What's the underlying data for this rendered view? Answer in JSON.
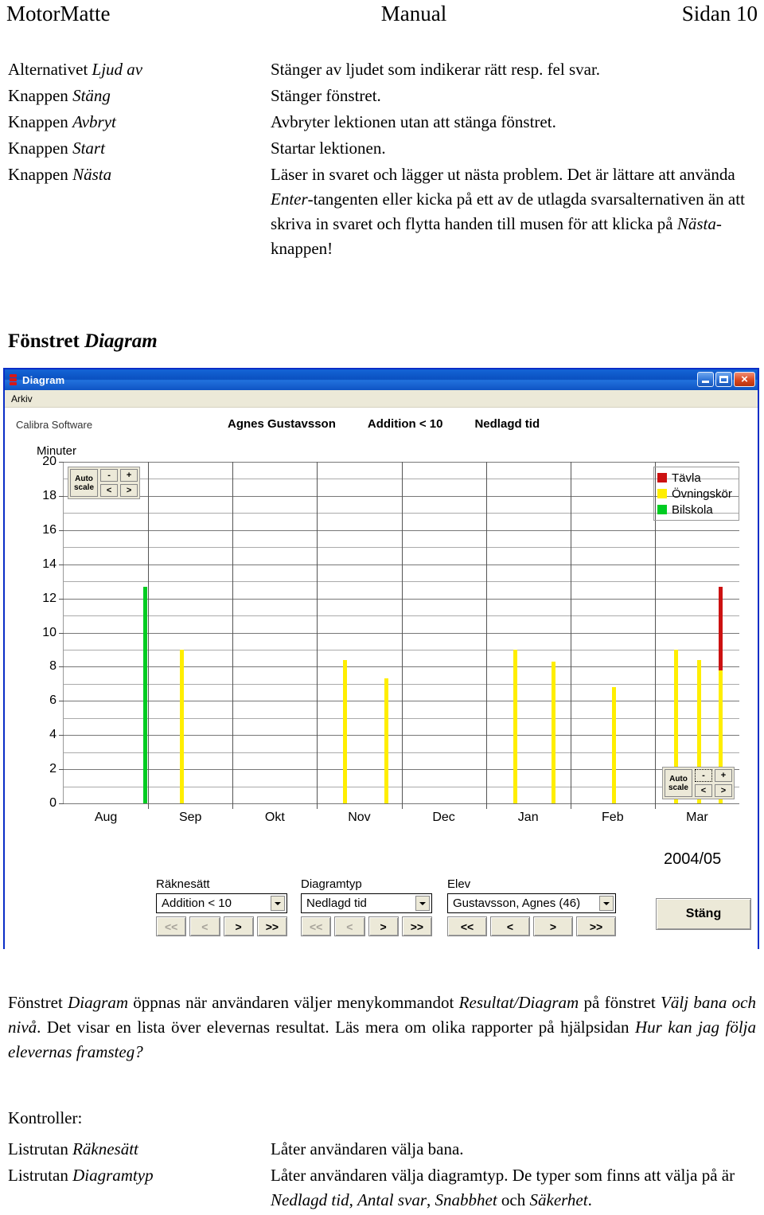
{
  "page_header": {
    "left": "MotorMatte",
    "center": "Manual",
    "right": "Sidan 10"
  },
  "definitions_top": [
    {
      "term_prefix": "Alternativet ",
      "term_italic": "Ljud av",
      "desc": "Stänger av ljudet som indikerar rätt resp. fel svar."
    },
    {
      "term_prefix": "Knappen ",
      "term_italic": "Stäng",
      "desc": "Stänger fönstret."
    },
    {
      "term_prefix": "Knappen ",
      "term_italic": "Avbryt",
      "desc": "Avbryter lektionen utan att stänga fönstret."
    },
    {
      "term_prefix": "Knappen ",
      "term_italic": "Start",
      "desc": "Startar lektionen."
    },
    {
      "term_prefix": "Knappen ",
      "term_italic": "Nästa",
      "desc_part1": "Läser in svaret och lägger ut nästa problem. Det är lättare att använda ",
      "desc_it1": "Enter",
      "desc_part2": "-tangenten eller kicka på ett av de utlagda svarsalternativen än att skriva in svaret och flytta handen till musen för att klicka på ",
      "desc_it2": "Nästa",
      "desc_part3": "-knappen!"
    }
  ],
  "section_heading": {
    "text": "Fönstret ",
    "italic": "Diagram"
  },
  "window": {
    "title": "Diagram",
    "titlebar_icon": "traffic-light-icon",
    "menu": [
      "Arkiv"
    ],
    "minimize_label": "minimize-icon",
    "maximize_label": "maximize-icon",
    "close_label": "×",
    "brand": "Calibra Software",
    "header_labels": [
      "Agnes Gustavsson",
      "Addition < 10",
      "Nedlagd tid"
    ],
    "year_label": "2004/05",
    "scale_controls": {
      "auto_line1": "Auto",
      "auto_line2": "scale",
      "minus": "-",
      "plus": "+",
      "prev": "<",
      "next": ">"
    },
    "controls": [
      {
        "label": "Räknesätt",
        "value": "Addition < 10",
        "nav": [
          {
            "label": "<<",
            "disabled": true
          },
          {
            "label": "<",
            "disabled": true
          },
          {
            "label": ">",
            "disabled": false
          },
          {
            "label": ">>",
            "disabled": false
          }
        ]
      },
      {
        "label": "Diagramtyp",
        "value": "Nedlagd tid",
        "nav": [
          {
            "label": "<<",
            "disabled": true
          },
          {
            "label": "<",
            "disabled": true
          },
          {
            "label": ">",
            "disabled": false
          },
          {
            "label": ">>",
            "disabled": false
          }
        ]
      },
      {
        "label": "Elev",
        "value": "Gustavsson, Agnes (46)",
        "nav": [
          {
            "label": "<<",
            "disabled": false
          },
          {
            "label": "<",
            "disabled": false
          },
          {
            "label": ">",
            "disabled": false
          },
          {
            "label": ">>",
            "disabled": false
          }
        ]
      }
    ],
    "close_button": "Stäng"
  },
  "chart_data": {
    "type": "bar",
    "title": "Nedlagd tid",
    "subtitle": "Agnes Gustavsson — Addition < 10",
    "xlabel": "",
    "ylabel": "Minuter",
    "ylim": [
      0,
      20
    ],
    "ytick_step": 2,
    "grid": true,
    "legend_position": "top-right",
    "categories": [
      "Aug",
      "Sep",
      "Okt",
      "Nov",
      "Dec",
      "Jan",
      "Feb",
      "Mar"
    ],
    "legend": [
      {
        "name": "Tävla",
        "color": "#cc1111"
      },
      {
        "name": "Övningskör",
        "color": "#ffee00"
      },
      {
        "name": "Bilskola",
        "color": "#00cc22"
      }
    ],
    "bars": [
      {
        "month": "Aug",
        "offset": 0.97,
        "series": "Bilskola",
        "color": "#00cc22",
        "base": 0,
        "value": 12.7
      },
      {
        "month": "Sep",
        "offset": 0.4,
        "series": "Övningskör",
        "color": "#ffee00",
        "base": 0,
        "value": 9.0
      },
      {
        "month": "Nov",
        "offset": 0.33,
        "series": "Övningskör",
        "color": "#ffee00",
        "base": 0,
        "value": 8.4
      },
      {
        "month": "Nov",
        "offset": 0.82,
        "series": "Övningskör",
        "color": "#ffee00",
        "base": 0,
        "value": 7.3
      },
      {
        "month": "Jan",
        "offset": 0.35,
        "series": "Övningskör",
        "color": "#ffee00",
        "base": 0,
        "value": 9.0
      },
      {
        "month": "Jan",
        "offset": 0.8,
        "series": "Övningskör",
        "color": "#ffee00",
        "base": 0,
        "value": 8.3
      },
      {
        "month": "Feb",
        "offset": 0.52,
        "series": "Övningskör",
        "color": "#ffee00",
        "base": 0,
        "value": 6.8
      },
      {
        "month": "Mar",
        "offset": 0.25,
        "series": "Övningskör",
        "color": "#ffee00",
        "base": 0,
        "value": 9.0
      },
      {
        "month": "Mar",
        "offset": 0.52,
        "series": "Övningskör",
        "color": "#ffee00",
        "base": 0,
        "value": 8.4
      },
      {
        "month": "Mar",
        "offset": 0.78,
        "series": "Övningskör",
        "color": "#ffee00",
        "base": 0,
        "value": 8.2
      },
      {
        "month": "Mar",
        "offset": 0.78,
        "series": "Tävla",
        "color": "#cc1111",
        "base": 7.8,
        "value": 12.7
      }
    ]
  },
  "paragraph": {
    "t1": "Fönstret ",
    "i1": "Diagram",
    "t2": " öppnas när användaren väljer menykommandot ",
    "i2": "Resultat/Diagram",
    "t3": " på fönstret ",
    "i3": "Välj bana och nivå",
    "t4": ". Det visar en lista över elevernas resultat. Läs mera om olika rapporter på hjälpsidan ",
    "i4": "Hur kan jag följa elevernas framsteg?"
  },
  "kontroller_heading": "Kontroller:",
  "definitions_bottom": [
    {
      "term_prefix": "Listrutan ",
      "term_italic": "Räknesätt",
      "desc": "Låter användaren välja bana."
    },
    {
      "term_prefix": "Listrutan ",
      "term_italic": "Diagramtyp",
      "desc_part1": "Låter användaren välja diagramtyp. De typer som finns att välja på är ",
      "desc_it1": "Nedlagd tid",
      "desc_sep1": ", ",
      "desc_it2": "Antal svar",
      "desc_sep2": ", ",
      "desc_it3": "Snabbhet",
      "desc_sep3": " och ",
      "desc_it4": "Säkerhet",
      "desc_end": "."
    }
  ]
}
